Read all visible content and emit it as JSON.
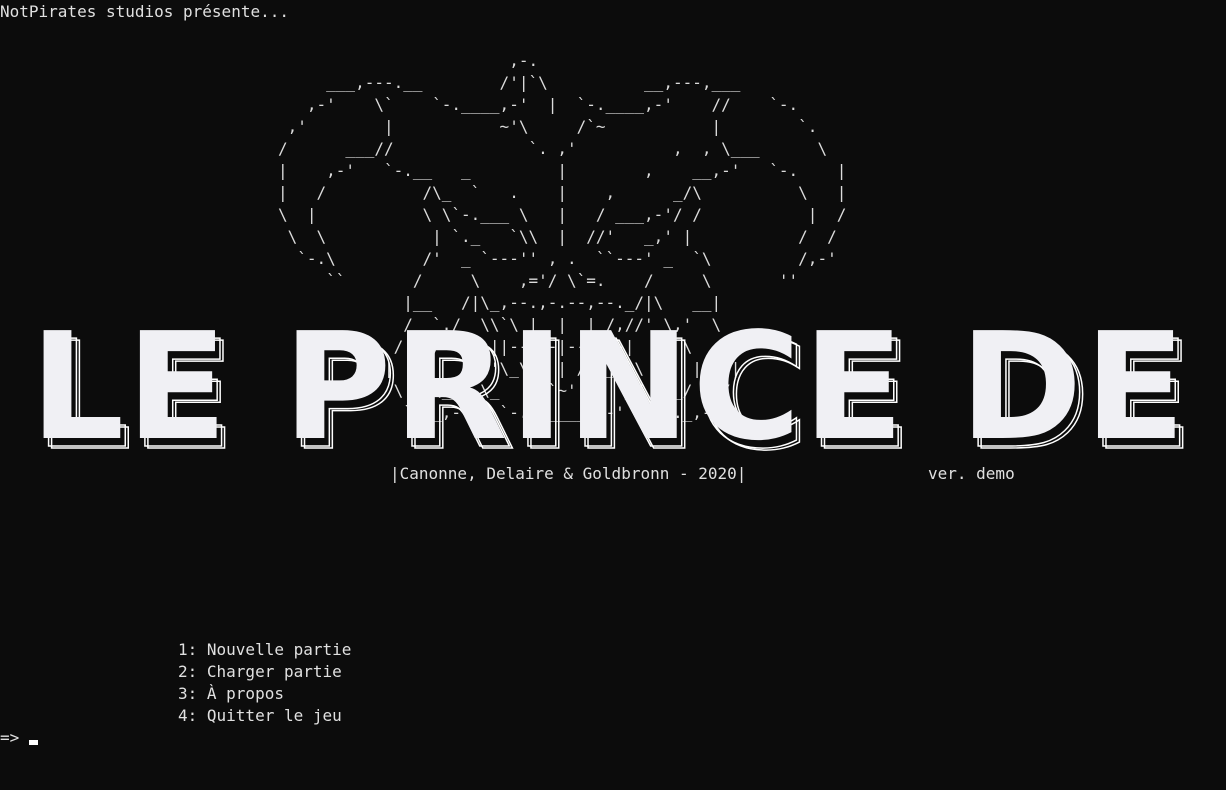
{
  "header": {
    "presents": "NotPirates studios présente..."
  },
  "art": {
    "demon": "                        ,-.\n     ___,---.__        /'|`\\          __,---,___\n   ,-'    \\`    `-.____,-'  |  `-.____,-'    //    `-.\n ,'        |           ~'\\     /`~           |        `.\n/      ___//              `. ,'          ,  , \\___      \\\n|    ,-'   `-.__   _         |        ,    __,-'   `-.    |\n|   /          /\\_  `   .    |    ,      _/\\          \\   |\n\\  |           \\ \\`-.___ \\   |   / ___,-'/ /           |  /\n \\  \\           | `._   `\\\\  |  //'   _,' |           /  /\n  `-.\\         /'  _ `---'' , .  ``---' _  `\\         /,-'\n     ``       /     \\    ,='/ \\`=.    /     \\       ''\n             |__   /|\\_,--.,-.--,--._/|\\   __|\n             /  `./  \\\\`\\ |  |  | /,//' \\,'  \\\n            /   /     ||--+--|--+-/-|     \\   \\\n           |   |     /'\\_\\_\\ | /_/_/`\\     |   |\n            \\   \\__, \\_     `~'     _/ .__/   /\n             `-._,-'   `-._______,-'   `-._,-'",
    "credits": "|Canonne, Delaire & Goldbronn - 2020|",
    "version": "ver. demo"
  },
  "title": {
    "text": "LE PRINCE DEMON",
    "fill_color": "#f0f0f4",
    "outline_color": "#ffffff"
  },
  "menu": {
    "items": [
      "1: Nouvelle partie",
      "2: Charger partie",
      "3: À propos",
      "4: Quitter le jeu"
    ]
  },
  "prompt": {
    "symbol": "=>"
  }
}
